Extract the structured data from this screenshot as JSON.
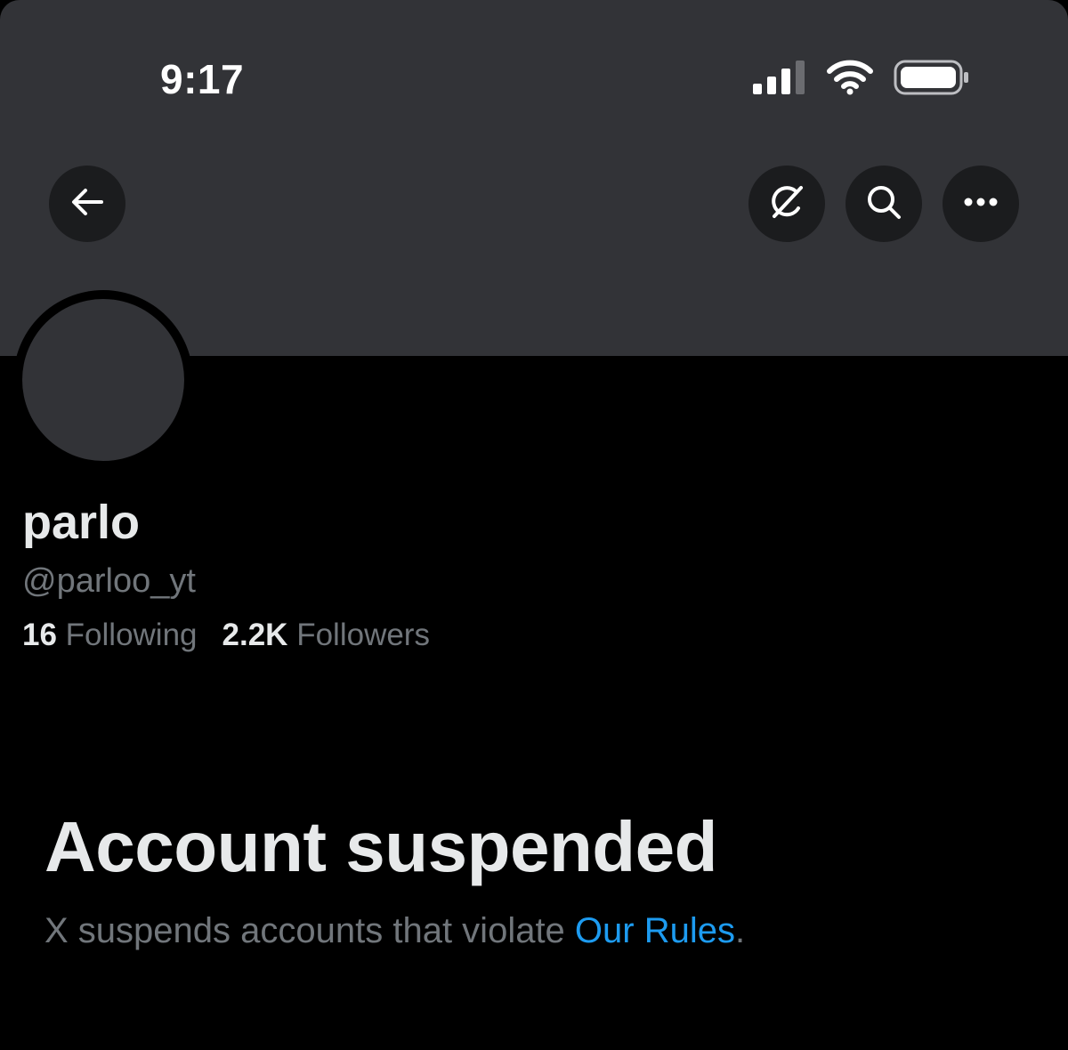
{
  "status_bar": {
    "time": "9:17",
    "icons": [
      "cellular-signal-icon",
      "wifi-icon",
      "battery-icon"
    ]
  },
  "header": {
    "buttons": [
      "back-arrow-icon",
      "grok-icon",
      "search-icon",
      "more-icon"
    ]
  },
  "profile": {
    "display_name": "parlo",
    "handle": "@parloo_yt",
    "following_count": "16",
    "following_label": "Following",
    "followers_count": "2.2K",
    "followers_label": "Followers"
  },
  "suspension": {
    "title": "Account suspended",
    "description": "X suspends accounts that violate ",
    "link_text": "Our Rules",
    "trailing": "."
  },
  "colors": {
    "banner": "#323337",
    "background": "#000000",
    "text_primary": "#e7e9ea",
    "text_secondary": "#71767b",
    "link": "#1d9bf0"
  }
}
